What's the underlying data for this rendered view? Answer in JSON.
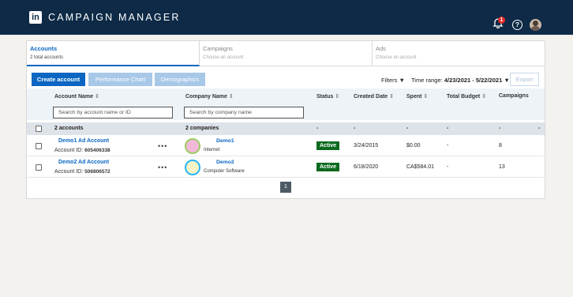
{
  "app": {
    "logo_text": "in",
    "title": "CAMPAIGN MANAGER",
    "notification_count": "1",
    "help_symbol": "?"
  },
  "steps": [
    {
      "title": "Accounts",
      "subtitle": "2 total accounts"
    },
    {
      "title": "Campaigns",
      "subtitle": "Choose an account"
    },
    {
      "title": "Ads",
      "subtitle": "Choose an account"
    }
  ],
  "toolbar": {
    "create_account": "Create account",
    "performance_chart": "Performance Chart",
    "demographics": "Demographics",
    "filters": "Filters ▼",
    "time_range_label": "Time range:",
    "time_range_value": "4/23/2021 - 5/22/2021 ▼",
    "export": "Export"
  },
  "columns": {
    "account_name": "Account Name",
    "company_name": "Company Name",
    "status": "Status",
    "created_date": "Created Date",
    "spent": "Spent",
    "total_budget": "Total Budget",
    "campaigns": "Campaigns",
    "sort_glyph": "⇕"
  },
  "search": {
    "account_placeholder": "Search by account name or ID",
    "company_placeholder": "Search by company name"
  },
  "summary": {
    "accounts": "2 accounts",
    "companies": "2 companies",
    "dash": "-"
  },
  "rows": [
    {
      "account_name": "Demo1 Ad Account",
      "account_id_label": "Account ID:",
      "account_id": "605406338",
      "more": "•••",
      "company_name": "Demo1",
      "industry": "Internet",
      "status": "Active",
      "created_date": "3/24/2015",
      "spent": "$0.00",
      "total_budget": "-",
      "campaigns": "8",
      "avatar_fill": "#f2b8d8",
      "avatar_ring": "#9ccc65"
    },
    {
      "account_name": "Demo2 Ad Account",
      "account_id_label": "Account ID:",
      "account_id": "506806572",
      "more": "•••",
      "company_name": "Demo2",
      "industry": "Computer Software",
      "status": "Active",
      "created_date": "6/18/2020",
      "spent": "CA$584.01",
      "total_budget": "-",
      "campaigns": "13",
      "avatar_fill": "#f7f3c6",
      "avatar_ring": "#29b6f6"
    }
  ],
  "pagination": {
    "current_page": "1"
  },
  "colors": {
    "nav_bg": "#0e2a47",
    "primary": "#0a66c2",
    "active_badge": "#0c6a1f"
  }
}
